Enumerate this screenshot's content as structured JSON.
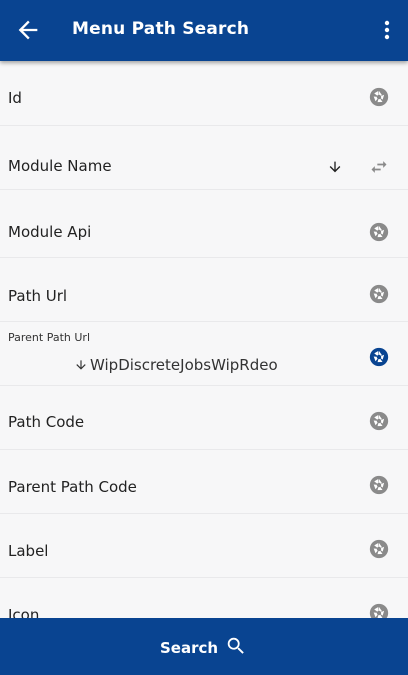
{
  "header": {
    "title": "Menu Path Search",
    "back_icon": "arrow-left-icon",
    "more_icon": "more-vert-icon"
  },
  "fields": [
    {
      "label": "Id"
    },
    {
      "label": "Module Name"
    },
    {
      "label": "Module Api"
    },
    {
      "label": "Path Url"
    },
    {
      "label": "Parent Path Url",
      "value": "WipDiscreteJobsWipRdeo"
    },
    {
      "label": "Path Code"
    },
    {
      "label": "Parent Path Code"
    },
    {
      "label": "Label"
    },
    {
      "label": "Icon"
    }
  ],
  "footer": {
    "search_label": "Search",
    "search_icon": "search-icon"
  },
  "colors": {
    "primary": "#094491",
    "icon_inactive": "#8a8a8a",
    "icon_active": "#094491",
    "background": "#f7f7f8"
  }
}
